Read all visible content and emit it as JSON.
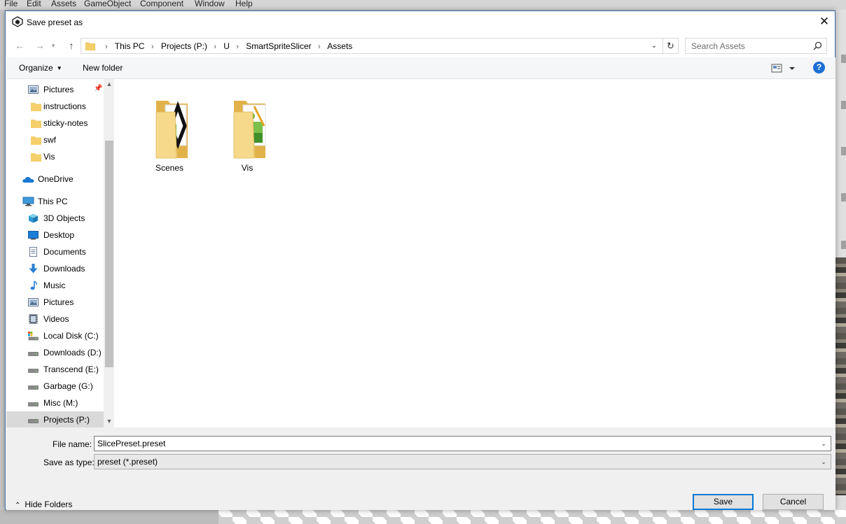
{
  "unity_menu": [
    "File",
    "Edit",
    "Assets",
    "GameObject",
    "Component",
    "Window",
    "Help"
  ],
  "dialog": {
    "title": "Save preset as",
    "close_label": "✕"
  },
  "address": {
    "crumbs": [
      "This PC",
      "Projects (P:)",
      "U",
      "SmartSpriteSlicer",
      "Assets"
    ]
  },
  "search": {
    "placeholder": "Search Assets"
  },
  "toolbar": {
    "organize_label": "Organize",
    "new_folder_label": "New folder",
    "help_label": "?"
  },
  "nav": {
    "items": [
      {
        "label": "Pictures",
        "icon": "pictures-icon",
        "pinned": true
      },
      {
        "label": "instructions",
        "icon": "folder-icon"
      },
      {
        "label": "sticky-notes",
        "icon": "folder-icon"
      },
      {
        "label": "swf",
        "icon": "folder-icon"
      },
      {
        "label": "Vis",
        "icon": "folder-icon"
      },
      {
        "label": "OneDrive",
        "icon": "onedrive-icon"
      },
      {
        "label": "This PC",
        "icon": "this-pc-icon"
      },
      {
        "label": "3D Objects",
        "icon": "3d-objects-icon"
      },
      {
        "label": "Desktop",
        "icon": "desktop-icon"
      },
      {
        "label": "Documents",
        "icon": "documents-icon"
      },
      {
        "label": "Downloads",
        "icon": "downloads-icon"
      },
      {
        "label": "Music",
        "icon": "music-icon"
      },
      {
        "label": "Pictures",
        "icon": "pictures-icon"
      },
      {
        "label": "Videos",
        "icon": "videos-icon"
      },
      {
        "label": "Local Disk (C:)",
        "icon": "system-drive-icon"
      },
      {
        "label": "Downloads (D:)",
        "icon": "drive-icon"
      },
      {
        "label": "Transcend (E:)",
        "icon": "drive-icon"
      },
      {
        "label": "Garbage (G:)",
        "icon": "drive-icon"
      },
      {
        "label": "Misc (M:)",
        "icon": "drive-icon"
      },
      {
        "label": "Projects (P:)",
        "icon": "drive-icon",
        "selected": true
      }
    ]
  },
  "files": [
    {
      "name": "Scenes",
      "icon": "folder-with-scene-preview-icon"
    },
    {
      "name": "Vis",
      "icon": "folder-with-image-preview-icon"
    }
  ],
  "bottom": {
    "file_name_label": "File name:",
    "file_name_value": "SlicePreset.preset",
    "save_type_label": "Save as type:",
    "save_type_value": "preset (*.preset)",
    "hide_folders_label": "Hide Folders",
    "save_label": "Save",
    "cancel_label": "Cancel"
  },
  "colors": {
    "accent": "#0078d7",
    "help": "#1c6fd6",
    "folder": "#f4cf6b",
    "selected_nav": "#d9d9d9"
  }
}
